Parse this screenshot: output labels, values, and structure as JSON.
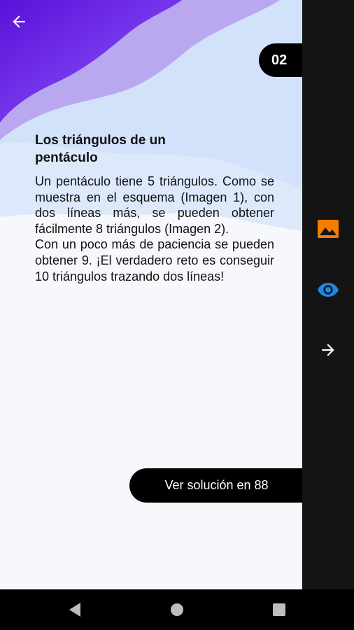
{
  "header": {
    "page_number": "02"
  },
  "content": {
    "title_line1": "Los triángulos de un",
    "title_line2": "pentáculo",
    "paragraph1": "Un pentáculo tiene 5 triángulos. Como se muestra en el esquema (Imagen 1), con dos líneas más, se pueden obtener fácilmente 8 triángulos (Imagen 2).",
    "paragraph2": "Con un poco más de paciencia se pueden obtener 9. ¡El verdadero reto es conseguir 10 triángulos trazando dos líneas!"
  },
  "solution_button": {
    "label": "Ver solución en 88"
  },
  "side_panel": {
    "icons": [
      "image-icon",
      "eye-icon",
      "arrow-right-icon"
    ],
    "colors": {
      "image": "#f57c00",
      "eye": "#1e88e5",
      "arrow": "#ffffff"
    }
  },
  "navigation_bar": {
    "buttons": [
      "back",
      "home",
      "recents"
    ]
  }
}
